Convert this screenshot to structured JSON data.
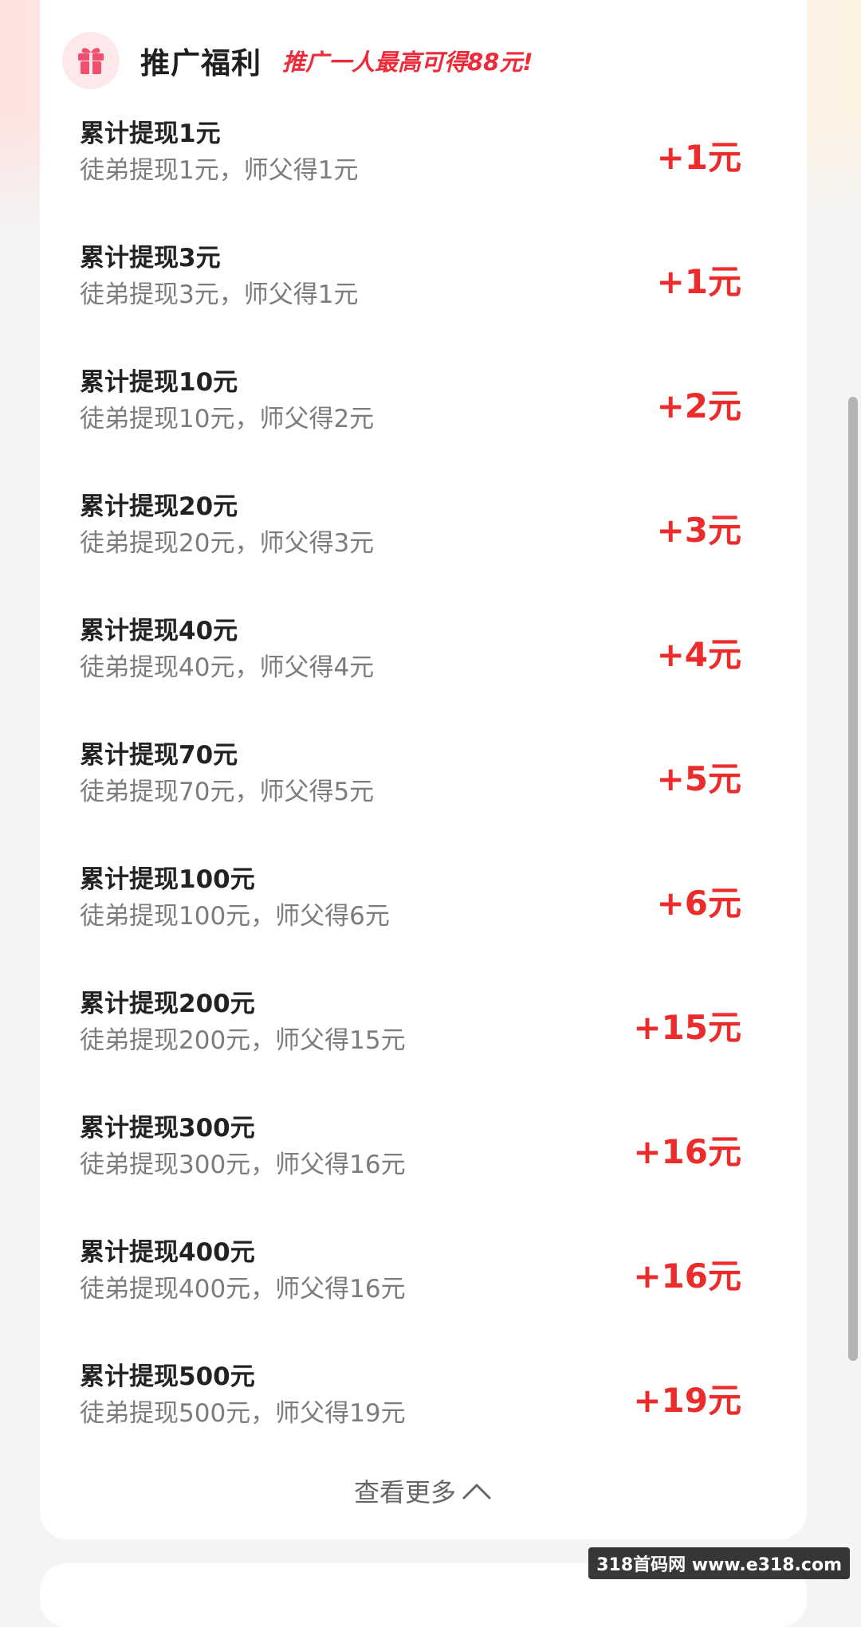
{
  "header": {
    "title": "推广福利",
    "subtitle": "推广一人最高可得88元!"
  },
  "rewards": [
    {
      "title": "累计提现1元",
      "desc": "徒弟提现1元，师父得1元",
      "reward": "+1元"
    },
    {
      "title": "累计提现3元",
      "desc": "徒弟提现3元，师父得1元",
      "reward": "+1元"
    },
    {
      "title": "累计提现10元",
      "desc": "徒弟提现10元，师父得2元",
      "reward": "+2元"
    },
    {
      "title": "累计提现20元",
      "desc": "徒弟提现20元，师父得3元",
      "reward": "+3元"
    },
    {
      "title": "累计提现40元",
      "desc": "徒弟提现40元，师父得4元",
      "reward": "+4元"
    },
    {
      "title": "累计提现70元",
      "desc": "徒弟提现70元，师父得5元",
      "reward": "+5元"
    },
    {
      "title": "累计提现100元",
      "desc": "徒弟提现100元，师父得6元",
      "reward": "+6元"
    },
    {
      "title": "累计提现200元",
      "desc": "徒弟提现200元，师父得15元",
      "reward": "+15元"
    },
    {
      "title": "累计提现300元",
      "desc": "徒弟提现300元，师父得16元",
      "reward": "+16元"
    },
    {
      "title": "累计提现400元",
      "desc": "徒弟提现400元，师父得16元",
      "reward": "+16元"
    },
    {
      "title": "累计提现500元",
      "desc": "徒弟提现500元，师父得19元",
      "reward": "+19元"
    }
  ],
  "more_label": "查看更多",
  "watermark": "318首码网 www.e318.com",
  "colors": {
    "accent": "#ec2b2b",
    "subtitle": "#ec2b3b",
    "icon": "#f0506e"
  },
  "icons": {
    "header": "gift-icon",
    "more": "chevron-up-icon"
  }
}
